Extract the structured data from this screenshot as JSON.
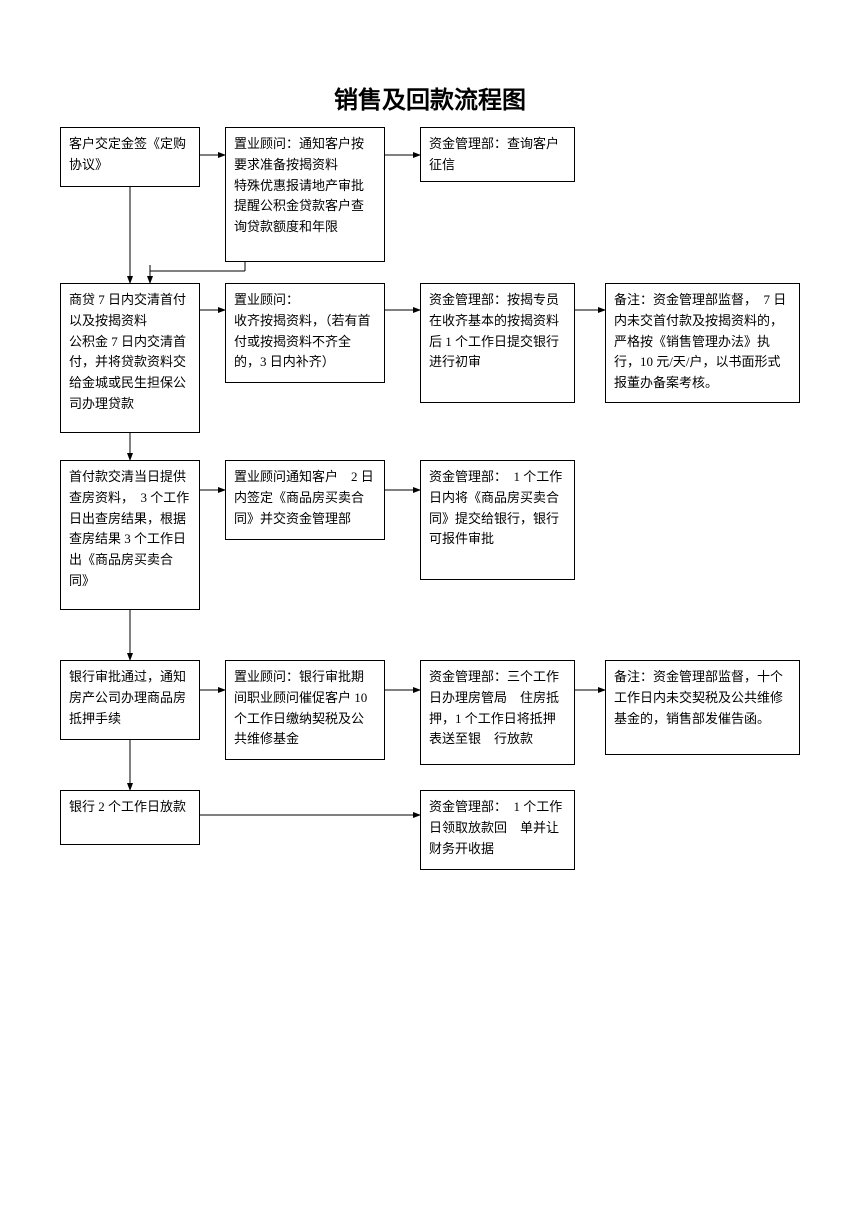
{
  "title": "销售及回款流程图",
  "boxes": {
    "r1c1": "客户交定金签《定购协议》",
    "r1c2": "置业顾问：通知客户按要求准备按揭资料\n特殊优惠报请地产审批\n提醒公积金贷款客户查询贷款额度和年限",
    "r1c3": "资金管理部：查询客户征信",
    "r2c1": "商贷 7 日内交清首付以及按揭资料\n公积金 7 日内交清首付，并将贷款资料交给金城或民生担保公司办理贷款",
    "r2c2": "置业顾问：\n收齐按揭资料，（若有首付或按揭资料不齐全的，3 日内补齐）",
    "r2c3": "资金管理部：按揭专员在收齐基本的按揭资料后 1 个工作日提交银行进行初审",
    "r2c4": "备注：资金管理部监督，　7 日内未交首付款及按揭资料的，严格按《销售管理办法》执行，10 元/天/户，以书面形式报董办备案考核。",
    "r3c1": "首付款交清当日提供查房资料，　3 个工作日出查房结果，根据查房结果 3 个工作日出《商品房买卖合同》",
    "r3c2": "置业顾问通知客户　2 日内签定《商品房买卖合同》并交资金管理部",
    "r3c3": "资金管理部：　1 个工作日内将《商品房买卖合同》提交给银行，银行可报件审批",
    "r4c1": "银行审批通过，通知房产公司办理商品房抵押手续",
    "r4c2": "置业顾问：银行审批期间职业顾问催促客户 10 个工作日缴纳契税及公共维修基金",
    "r4c3": "资金管理部：三个工作日办理房管局　住房抵押，1 个工作日将抵押表送至银　行放款",
    "r4c4": "备注：资金管理部监督，十个工作日内未交契税及公共维修基金的，销售部发催告函。",
    "r5c1": "银行 2 个工作日放款",
    "r5c3": "资金管理部：　1 个工作日领取放款回　单并让财务开收据"
  }
}
